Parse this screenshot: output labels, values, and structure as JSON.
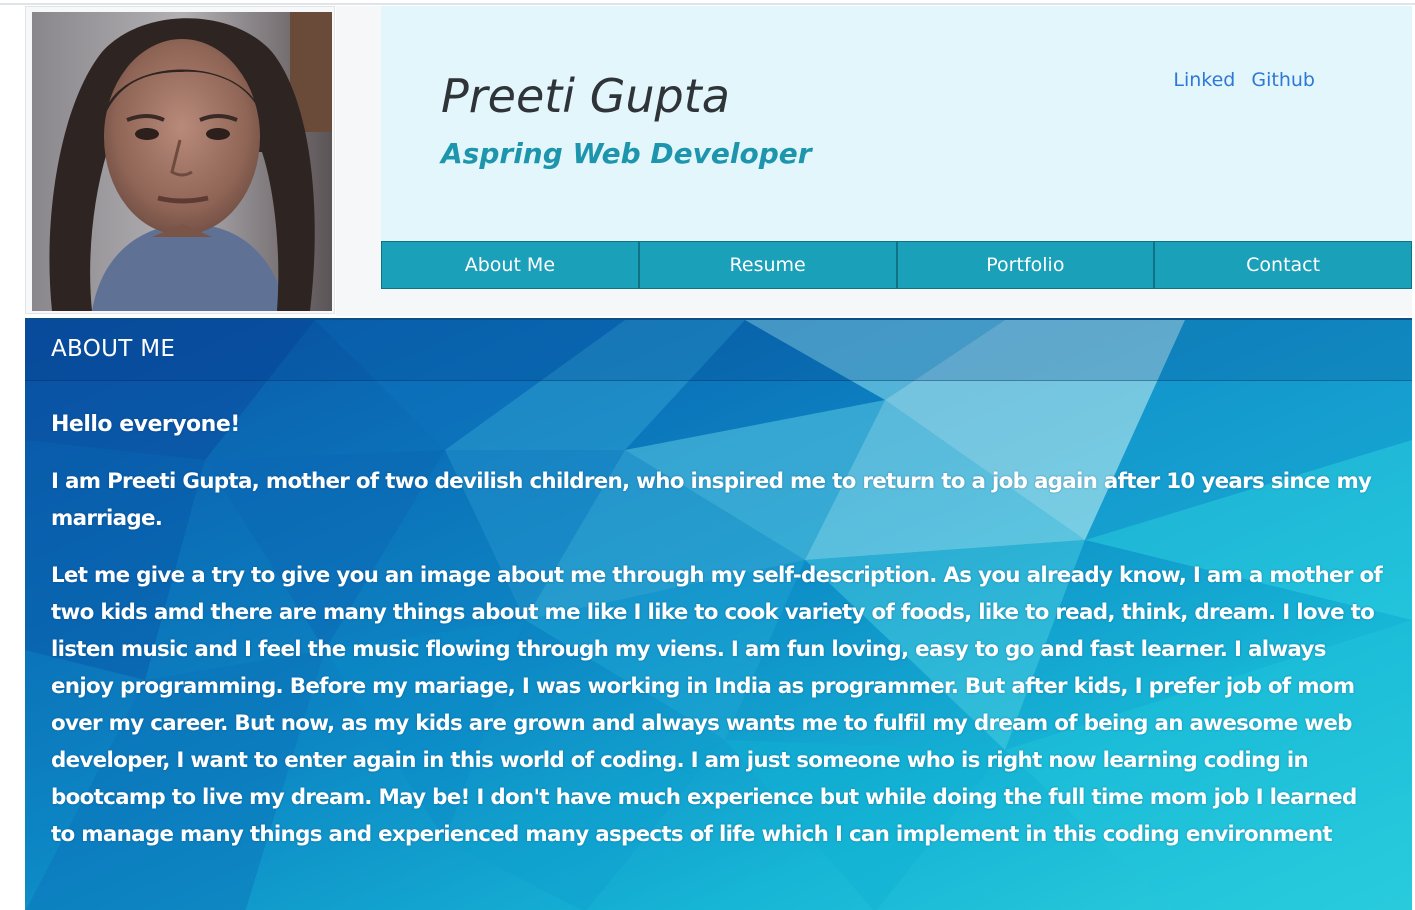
{
  "profile": {
    "photo_alt": "profile photo",
    "name": "Preeti Gupta",
    "tagline": "Aspring Web Developer"
  },
  "links": {
    "linkedin_label": "Linked",
    "github_label": "Github"
  },
  "nav": {
    "items": [
      {
        "label": "About Me"
      },
      {
        "label": "Resume"
      },
      {
        "label": "Portfolio"
      },
      {
        "label": "Contact"
      }
    ]
  },
  "about": {
    "heading": "ABOUT ME",
    "greeting": "Hello everyone!",
    "intro": "I am Preeti Gupta, mother of two devilish children, who inspired me to return to a job again after 10 years since my marriage.",
    "description": "Let me give a try to give you an image about me through my self-description. As you already know, I am a mother of two kids amd there are many things about me like I like to cook variety of foods, like to read, think, dream. I love to listen music and I feel the music flowing through my viens. I am fun loving, easy to go and fast learner. I always enjoy programming. Before my mariage, I was working in India as programmer. But after kids, I prefer job of mom over my career. But now, as my kids are grown and always wants me to fulfil my dream of being an awesome web developer, I want to enter again in this world of coding. I am just someone who is right now learning coding in bootcamp to live my dream. May be! I don't have much experience but while doing the full time mom job I learned to manage many things and experienced many aspects of life which I can implement in this coding environment"
  },
  "colors": {
    "nav_bg": "#1aa0b8",
    "hero_bg": "#e3f6fb",
    "tagline": "#1c95ad",
    "link": "#2f78d6",
    "card_dark": "#0a5fb0",
    "card_light": "#2fd0dd"
  }
}
